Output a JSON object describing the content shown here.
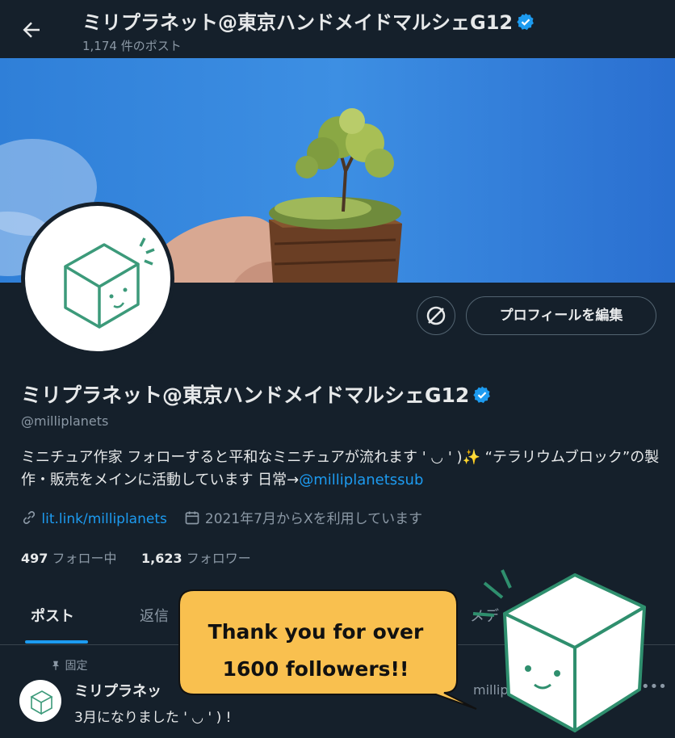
{
  "header": {
    "title": "ミリプラネット@東京ハンドメイドマルシェG12",
    "post_count": "1,174 件のポスト"
  },
  "profile": {
    "name": "ミリプラネット@東京ハンドメイドマルシェG12",
    "handle": "@milliplanets",
    "bio_part1": "ミニチュア作家 フォローすると平和なミニチュアが流れます ' ◡ ' )✨ “テラリウムブロック”の製作・販売をメインに活動しています 日常→",
    "bio_link": "@milliplanetssub",
    "website": "lit.link/milliplanets",
    "joined": "2021年7月からXを利用しています",
    "following_count": "497",
    "following_label": "フォロー中",
    "followers_count": "1,623",
    "followers_label": "フォロワー",
    "edit_button": "プロフィールを編集"
  },
  "tabs": [
    {
      "label": "ポスト",
      "active": true
    },
    {
      "label": "返信",
      "active": false
    },
    {
      "label": "メデ",
      "active": false
    }
  ],
  "pinned_post": {
    "pinned_label": "固定",
    "author": "ミリプラネッ",
    "handle": "millip",
    "text": "3月になりました ' ◡ ' ) !"
  },
  "overlay": {
    "bubble_line1": "Thank you for over",
    "bubble_line2": "1600 followers!!"
  },
  "colors": {
    "background": "#15202b",
    "accent": "#1d9bf0",
    "bubble": "#f9c04f",
    "cube_green": "#3c9a7a"
  },
  "icons": [
    "back-arrow-icon",
    "verified-badge-icon",
    "link-icon",
    "calendar-icon",
    "pin-icon",
    "more-icon",
    "grok-icon"
  ]
}
